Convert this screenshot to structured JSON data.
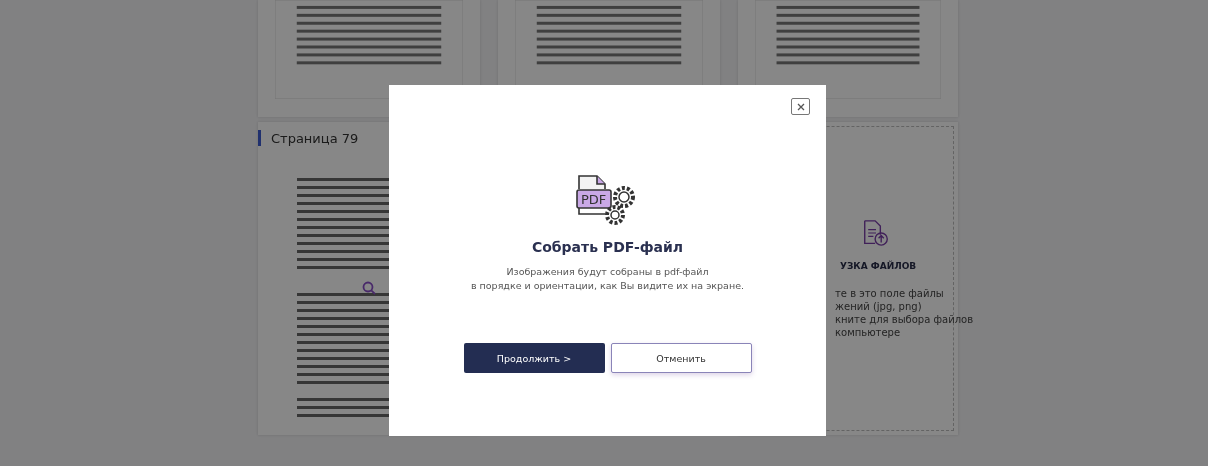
{
  "page_card": {
    "title": "Страница 79"
  },
  "upload_zone": {
    "title": "УЗКА ФАЙЛОВ",
    "lines": [
      "те в это поле файлы",
      "жений (jpg, png)",
      "кните для выбора файлов",
      "компьютере"
    ]
  },
  "dialog": {
    "icon_label": "PDF",
    "title": "Собрать PDF-файл",
    "description_lines": [
      "Изображения будут собраны в pdf-файл",
      "в порядке и ориентации, как Вы видите их на экране."
    ],
    "buttons": [
      {
        "label": "Продолжить >",
        "kind": "primary"
      },
      {
        "label": "Отменить",
        "kind": "secondary"
      }
    ]
  }
}
